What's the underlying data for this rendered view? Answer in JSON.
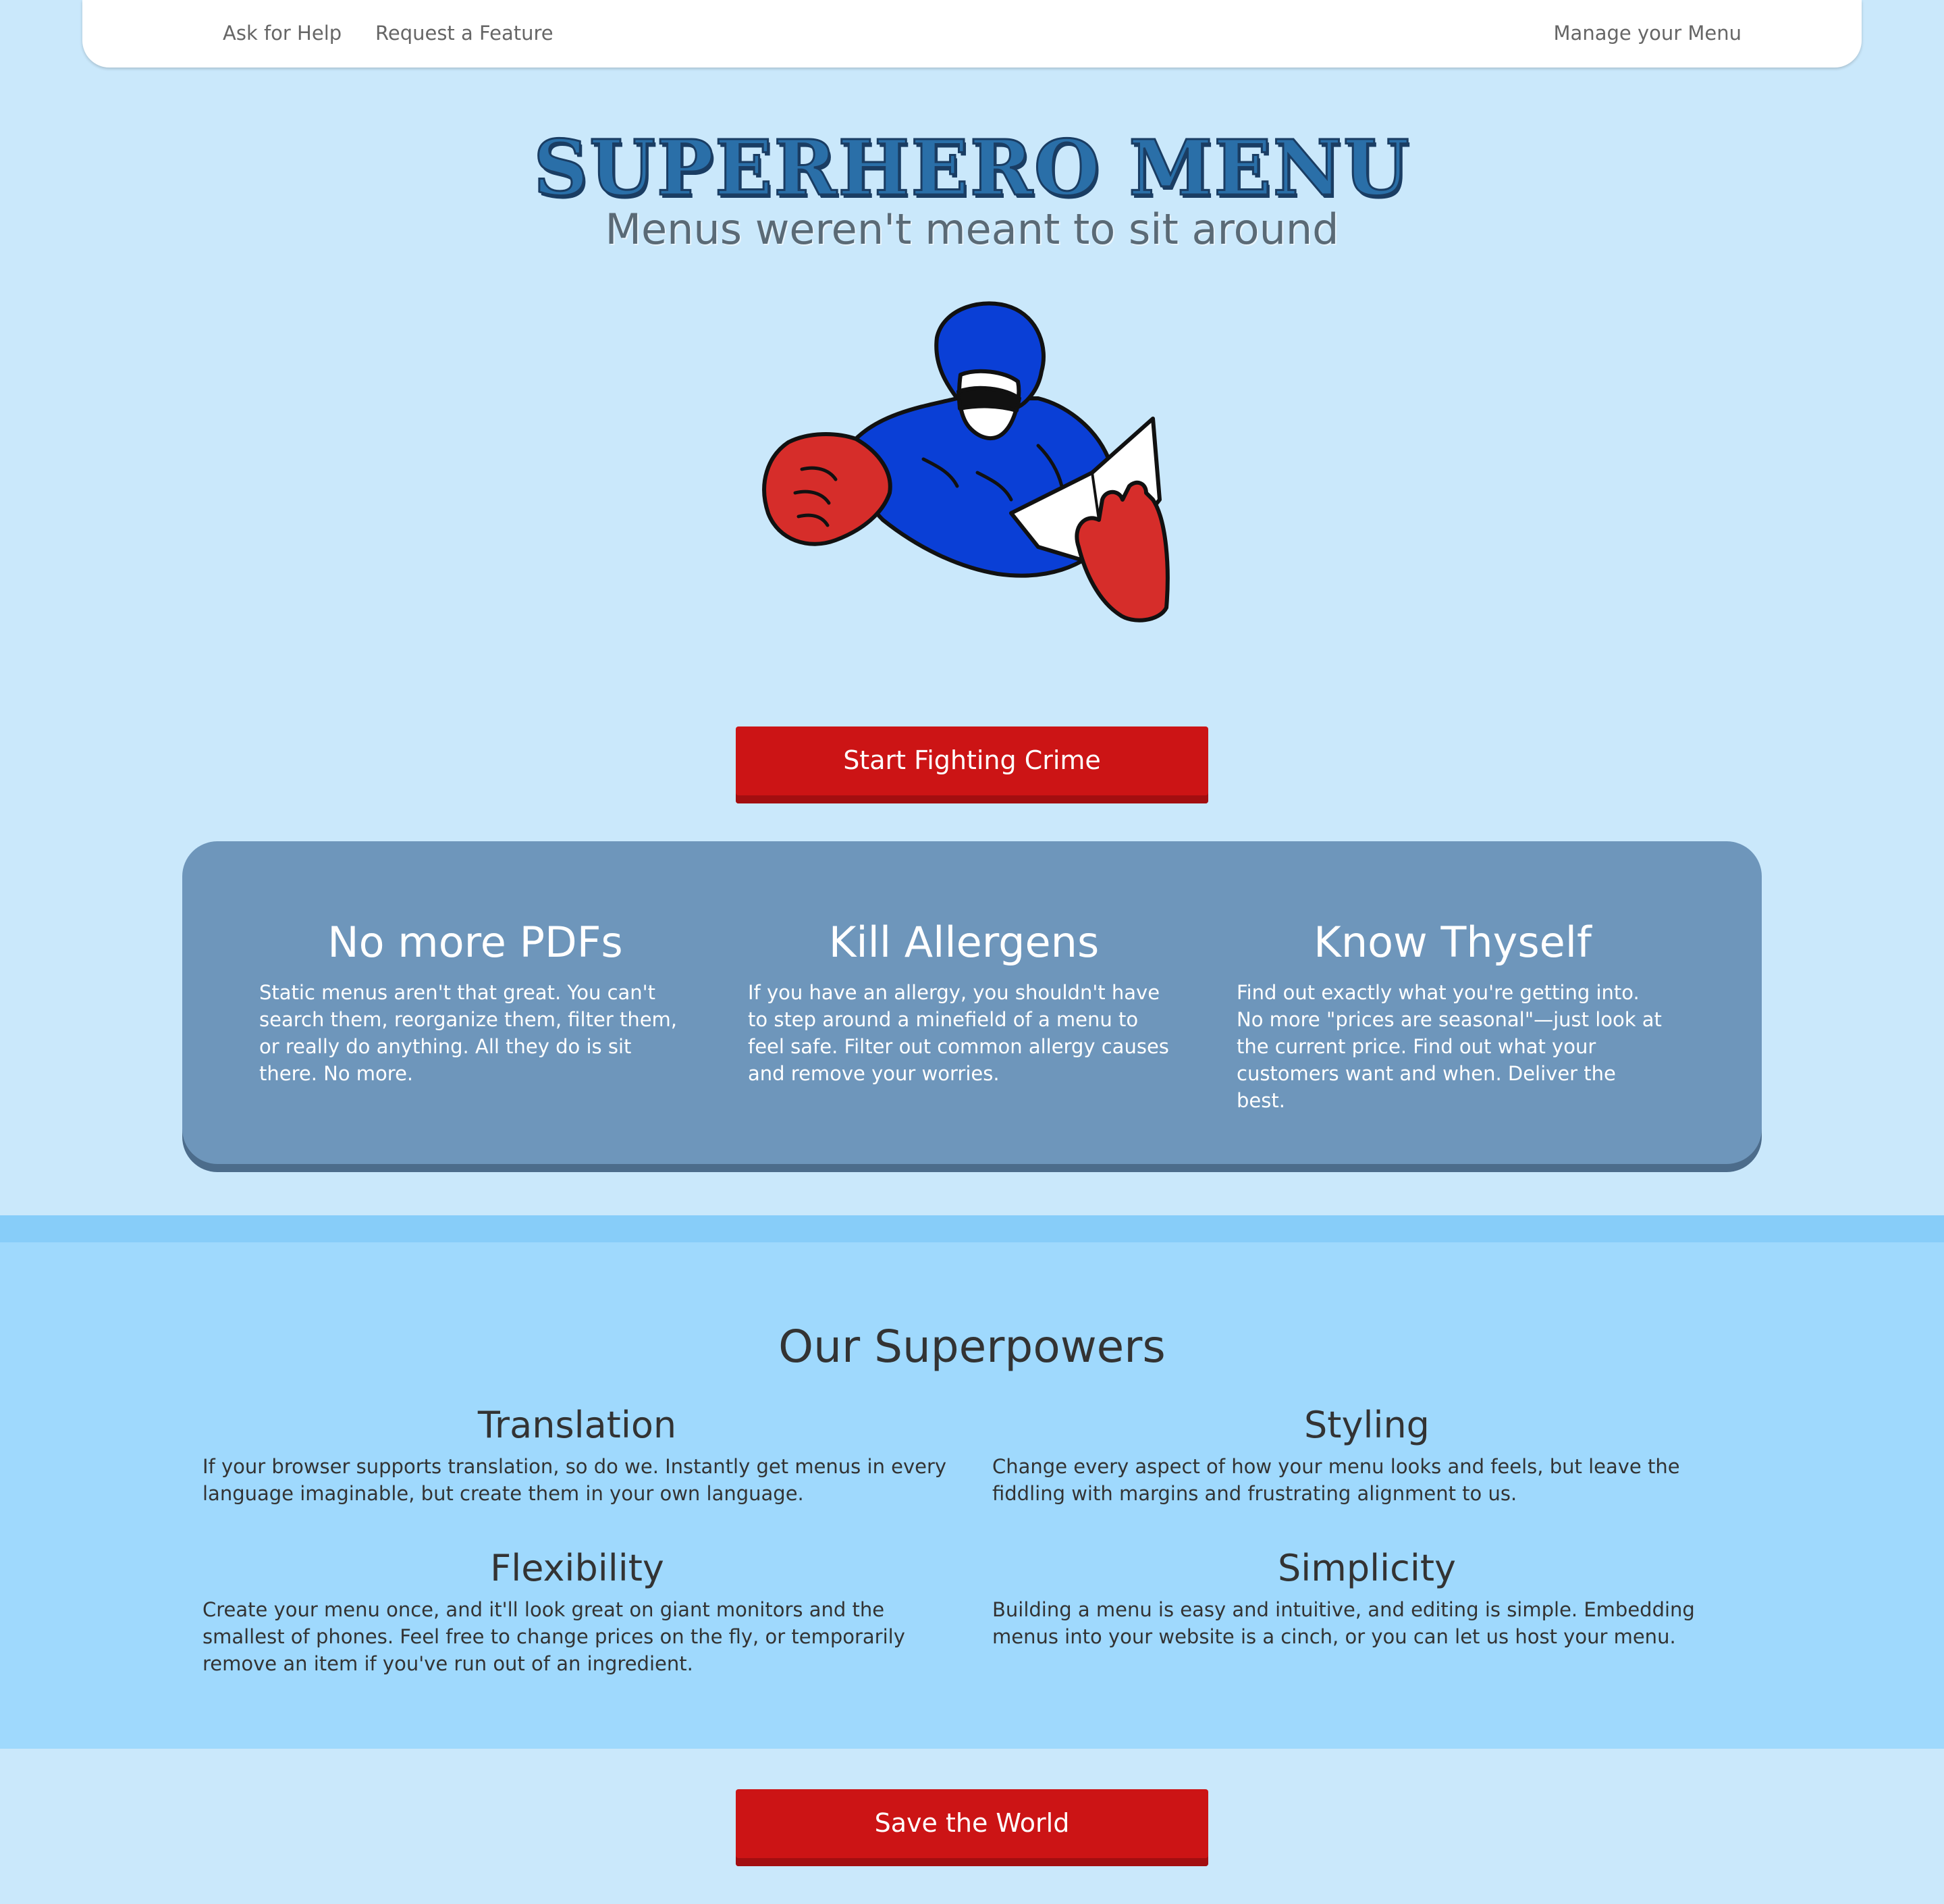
{
  "nav": {
    "help": "Ask for Help",
    "feature": "Request a Feature",
    "manage": "Manage your Menu"
  },
  "hero": {
    "title": "SUPERHERO MENU",
    "subtitle": "Menus weren't meant to sit around",
    "image_icon": "superhero-reading-menu-illustration",
    "cta": "Start Fighting Crime"
  },
  "features": [
    {
      "title": "No more PDFs",
      "text": "Static menus aren't that great. You can't search them, reorganize them, filter them, or really do anything. All they do is sit there. No more."
    },
    {
      "title": "Kill Allergens",
      "text": "If you have an allergy, you shouldn't have to step around a minefield of a menu to feel safe. Filter out common allergy causes and remove your worries."
    },
    {
      "title": "Know Thyself",
      "text": "Find out exactly what you're getting into. No more \"prices are seasonal\"—just look at the current price. Find out what your customers want and when. Deliver the best."
    }
  ],
  "powers": {
    "title": "Our Superpowers",
    "items": [
      {
        "title": "Translation",
        "text": "If your browser supports translation, so do we. Instantly get menus in every language imaginable, but create them in your own language."
      },
      {
        "title": "Styling",
        "text": "Change every aspect of how your menu looks and feels, but leave the fiddling with margins and frustrating alignment to us."
      },
      {
        "title": "Flexibility",
        "text": "Create your menu once, and it'll look great on giant monitors and the smallest of phones. Feel free to change prices on the fly, or temporarily remove an item if you've run out of an ingredient."
      },
      {
        "title": "Simplicity",
        "text": "Building a menu is easy and intuitive, and editing is simple. Embedding menus into your website is a cinch, or you can let us host your menu."
      }
    ]
  },
  "footer_cta": "Save the World",
  "colors": {
    "page_bg": "#cae8fb",
    "accent_red": "#cc1415",
    "panel_blue": "#6e96bb",
    "powers_bg": "#9fd9fd",
    "title_blue": "#2a6fa8"
  }
}
